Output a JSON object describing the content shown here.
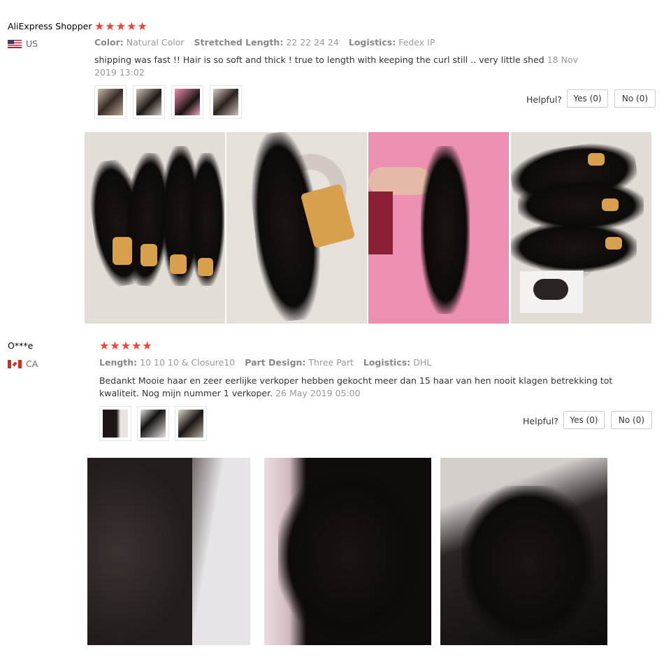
{
  "reviews": [
    {
      "name": "AliExpress Shopper",
      "country": "US",
      "stars": "★★★★★",
      "attributes": [
        {
          "key": "Color:",
          "value": "Natural Color"
        },
        {
          "key": "Stretched Length:",
          "value": "22 22 24 24"
        },
        {
          "key": "Logistics:",
          "value": "Fedex IP"
        }
      ],
      "text": "shipping was fast !! Hair is so soft and thick ! true to length with keeping the curl still .. very little shed",
      "date": "18 Nov 2019 13:02",
      "helpful_label": "Helpful?",
      "yes_label": "Yes (0)",
      "no_label": "No (0)"
    },
    {
      "name": "O***e",
      "country": "CA",
      "stars": "★★★★★",
      "attributes": [
        {
          "key": "Length:",
          "value": "10 10 10 & Closure10"
        },
        {
          "key": "Part Design:",
          "value": "Three Part"
        },
        {
          "key": "Logistics:",
          "value": "DHL"
        }
      ],
      "text": "Bedankt Mooie haar en zeer eerlijke verkoper hebben gekocht meer dan 15 haar van hen nooit klagen betrekking tot kwaliteit. Nog mijn nummer 1 verkoper.",
      "date": "26 May 2019 05:00",
      "helpful_label": "Helpful?",
      "yes_label": "Yes (0)",
      "no_label": "No (0)"
    }
  ],
  "colors": {
    "stars": "#f44336",
    "muted": "#999999",
    "border": "#cccccc"
  }
}
